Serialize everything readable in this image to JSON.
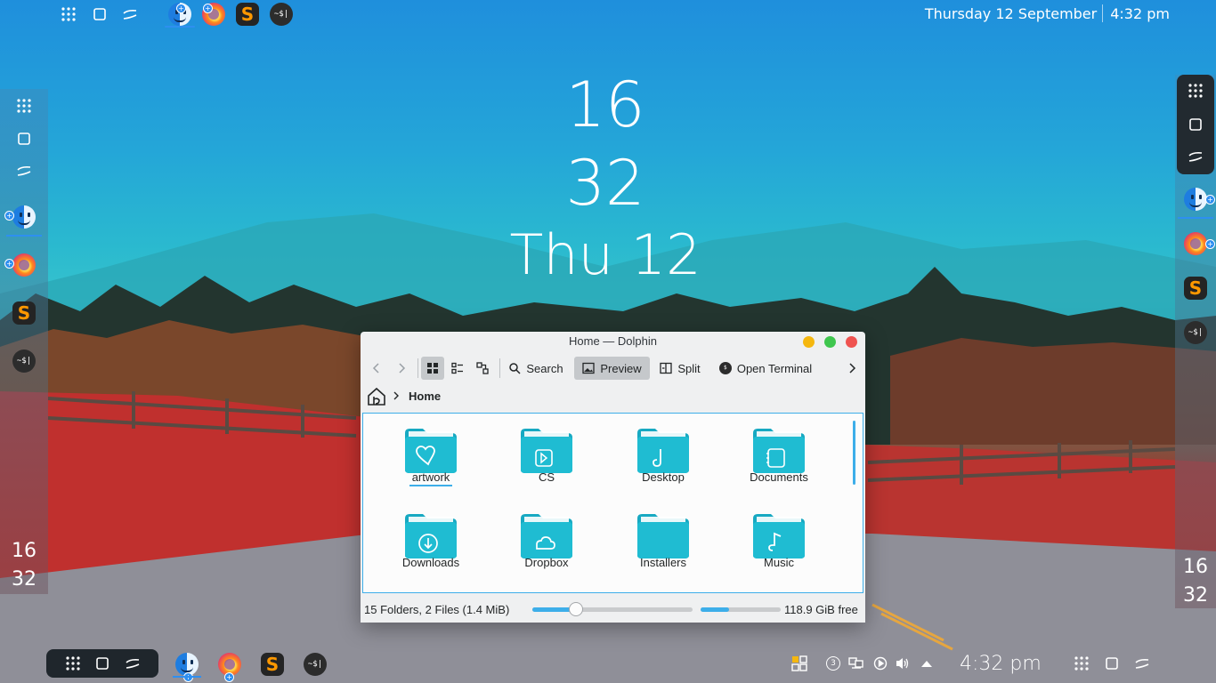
{
  "desktop": {
    "widget_clock": {
      "hour": "16",
      "minute": "32",
      "date": "Thu 12"
    }
  },
  "top_panel": {
    "date": "Thursday 12 September",
    "time": "4:32 pm",
    "tasks": [
      {
        "name": "finder",
        "active": true
      },
      {
        "name": "firefox",
        "active": false
      },
      {
        "name": "sublime-text",
        "active": false
      },
      {
        "name": "terminal",
        "active": false
      }
    ]
  },
  "left_panel": {
    "clock_hour": "16",
    "clock_minute": "32"
  },
  "right_panel": {
    "clock_hour": "16",
    "clock_minute": "32"
  },
  "bottom_panel": {
    "time": "4:32 pm",
    "tray_badge": "3"
  },
  "app_icons": {
    "sublime_letter": "S",
    "terminal_glyph": "~$|"
  },
  "dolphin": {
    "title": "Home — Dolphin",
    "toolbar": {
      "search": "Search",
      "preview": "Preview",
      "split": "Split",
      "open_terminal": "Open Terminal"
    },
    "breadcrumb": {
      "current": "Home"
    },
    "items": [
      {
        "name": "artwork",
        "emblem": "heart"
      },
      {
        "name": "CS",
        "emblem": "play"
      },
      {
        "name": "Desktop",
        "emblem": "note"
      },
      {
        "name": "Documents",
        "emblem": "doc"
      },
      {
        "name": "Downloads",
        "emblem": "download"
      },
      {
        "name": "Dropbox",
        "emblem": "cloud"
      },
      {
        "name": "Installers",
        "emblem": "none"
      },
      {
        "name": "Music",
        "emblem": "music"
      }
    ],
    "status": {
      "summary": "15 Folders, 2 Files (1.4 MiB)",
      "free_space": "118.9 GiB free",
      "zoom_level": 0.27,
      "disk_used_fraction": 0.35
    }
  },
  "colors": {
    "accent": "#3daee9",
    "folder": "#1fbcd2",
    "close": "#ef5350",
    "minimize": "#f5b70f",
    "maximize": "#3fc64e"
  }
}
